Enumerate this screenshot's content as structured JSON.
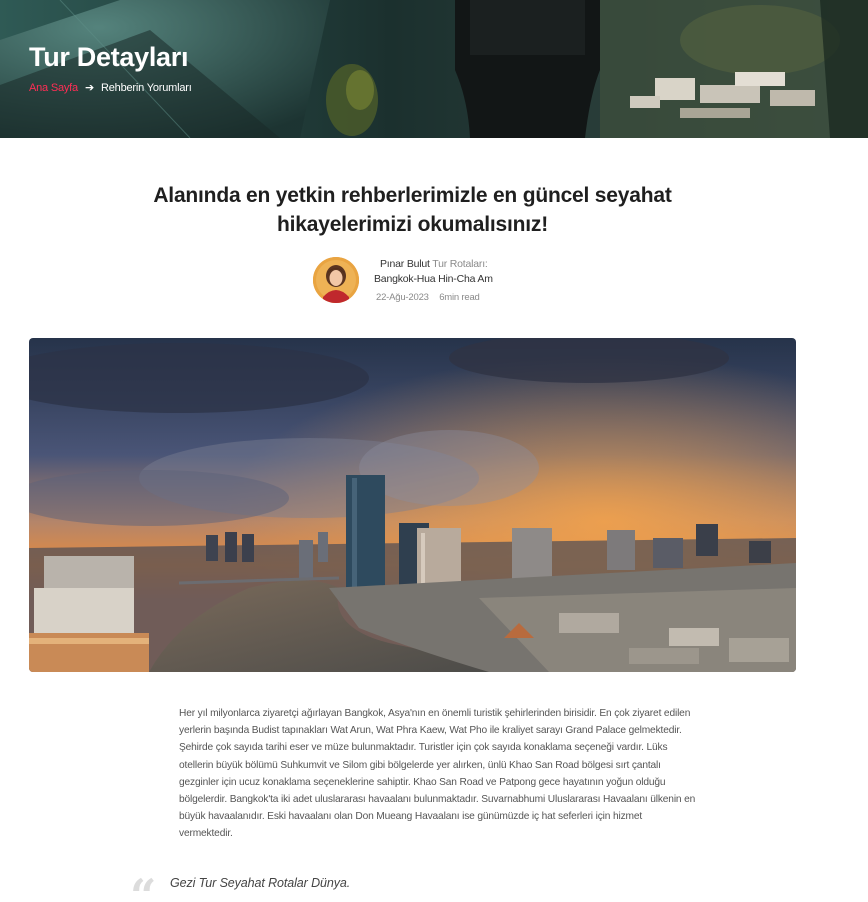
{
  "hero": {
    "title": "Tur Detayları",
    "breadcrumb": {
      "home": "Ana Sayfa",
      "separator_icon": "arrow-right-icon",
      "current": "Rehberin Yorumları"
    }
  },
  "post": {
    "title": "Alanında en yetkin rehberlerimizle en güncel seyahat hikayelerimizi okumalısınız!",
    "author": "Pınar Bulut",
    "category_prefix": "Tur Rotaları:",
    "route": "Bangkok-Hua Hin-Cha Am",
    "date": "22-Ağu-2023",
    "read_time": "6min read",
    "body": "Her yıl milyonlarca ziyaretçi ağırlayan Bangkok, Asya'nın en önemli turistik şehirlerinden birisidir. En çok ziyaret edilen yerlerin başında Budist tapınakları Wat Arun, Wat Phra Kaew, Wat Pho ile kraliyet sarayı Grand Palace gelmektedir. Şehirde çok sayıda tarihi eser ve müze bulunmaktadır. Turistler için çok sayıda konaklama seçeneği vardır. Lüks otellerin büyük bölümü Suhkumvit ve Silom gibi bölgelerde yer alırken, ünlü Khao San Road bölgesi sırt çantalı gezginler için ucuz konaklama seçeneklerine sahiptir. Khao San Road ve Patpong gece hayatının yoğun olduğu bölgelerdir. Bangkok'ta iki adet uluslararası havaalanı bulunmaktadır. Suvarnabhumi Uluslararası Havaalanı ülkenin en büyük havaalanıdır. Eski havaalanı olan Don Mueang Havaalanı ise günümüzde iç hat seferleri için hizmet vermektedir.",
    "quote": "Gezi Tur Seyahat Rotalar Dünya."
  },
  "colors": {
    "accent": "#ff2d55",
    "muted": "#8a8a8a"
  }
}
